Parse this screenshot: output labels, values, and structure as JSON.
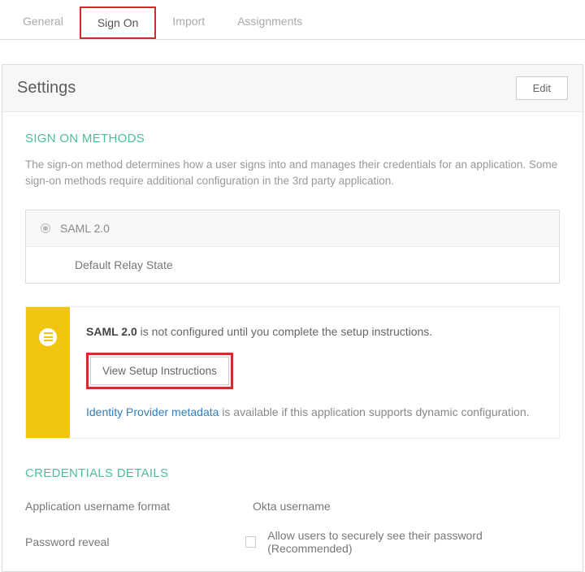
{
  "tabs": {
    "general": "General",
    "signon": "Sign On",
    "import": "Import",
    "assignments": "Assignments"
  },
  "panel": {
    "title": "Settings",
    "edit": "Edit"
  },
  "signon": {
    "title": "SIGN ON METHODS",
    "desc": "The sign-on method determines how a user signs into and manages their credentials for an application. Some sign-on methods require additional configuration in the 3rd party application.",
    "saml": "SAML 2.0",
    "relay": "Default Relay State"
  },
  "callout": {
    "bold": "SAML 2.0",
    "rest": " is not configured until you complete the setup instructions.",
    "setup": "View Setup Instructions",
    "link": "Identity Provider metadata",
    "tail": " is available if this application supports dynamic configuration."
  },
  "cred": {
    "title": "CREDENTIALS DETAILS",
    "uname_label": "Application username format",
    "uname_val": "Okta username",
    "pw_label": "Password reveal",
    "pw_val": "Allow users to securely see their password (Recommended)"
  }
}
